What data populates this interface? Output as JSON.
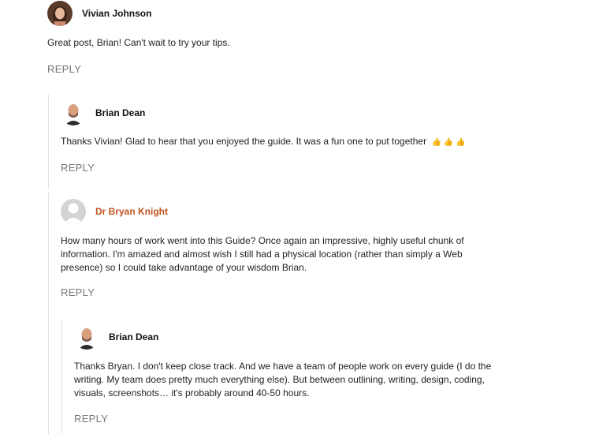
{
  "comments": [
    {
      "author": "Vivian Johnson",
      "text": "Great post, Brian! Can't wait to try your tips.",
      "reply_label": "REPLY"
    },
    {
      "author": "Brian Dean",
      "text": "Thanks Vivian! Glad to hear that you enjoyed the guide. It was a fun one to put together",
      "emojis": [
        "👍",
        "👍",
        "👍"
      ],
      "reply_label": "REPLY"
    },
    {
      "author": "Dr Bryan Knight",
      "author_color": "#c0531c",
      "text": "How many hours of work went into this Guide? Once again an impressive, highly useful chunk of information. I'm amazed and almost wish I still had a physical location (rather than simply a Web presence) so I could take advantage of your wisdom Brian.",
      "reply_label": "REPLY"
    },
    {
      "author": "Brian Dean",
      "text": "Thanks Bryan. I don't keep close track. And we have a team of people work on every guide (I do the writing. My team does pretty much everything else). But between outlining, writing, design, coding, visuals, screenshots… it's probably around 40-50 hours.",
      "reply_label": "REPLY"
    }
  ]
}
